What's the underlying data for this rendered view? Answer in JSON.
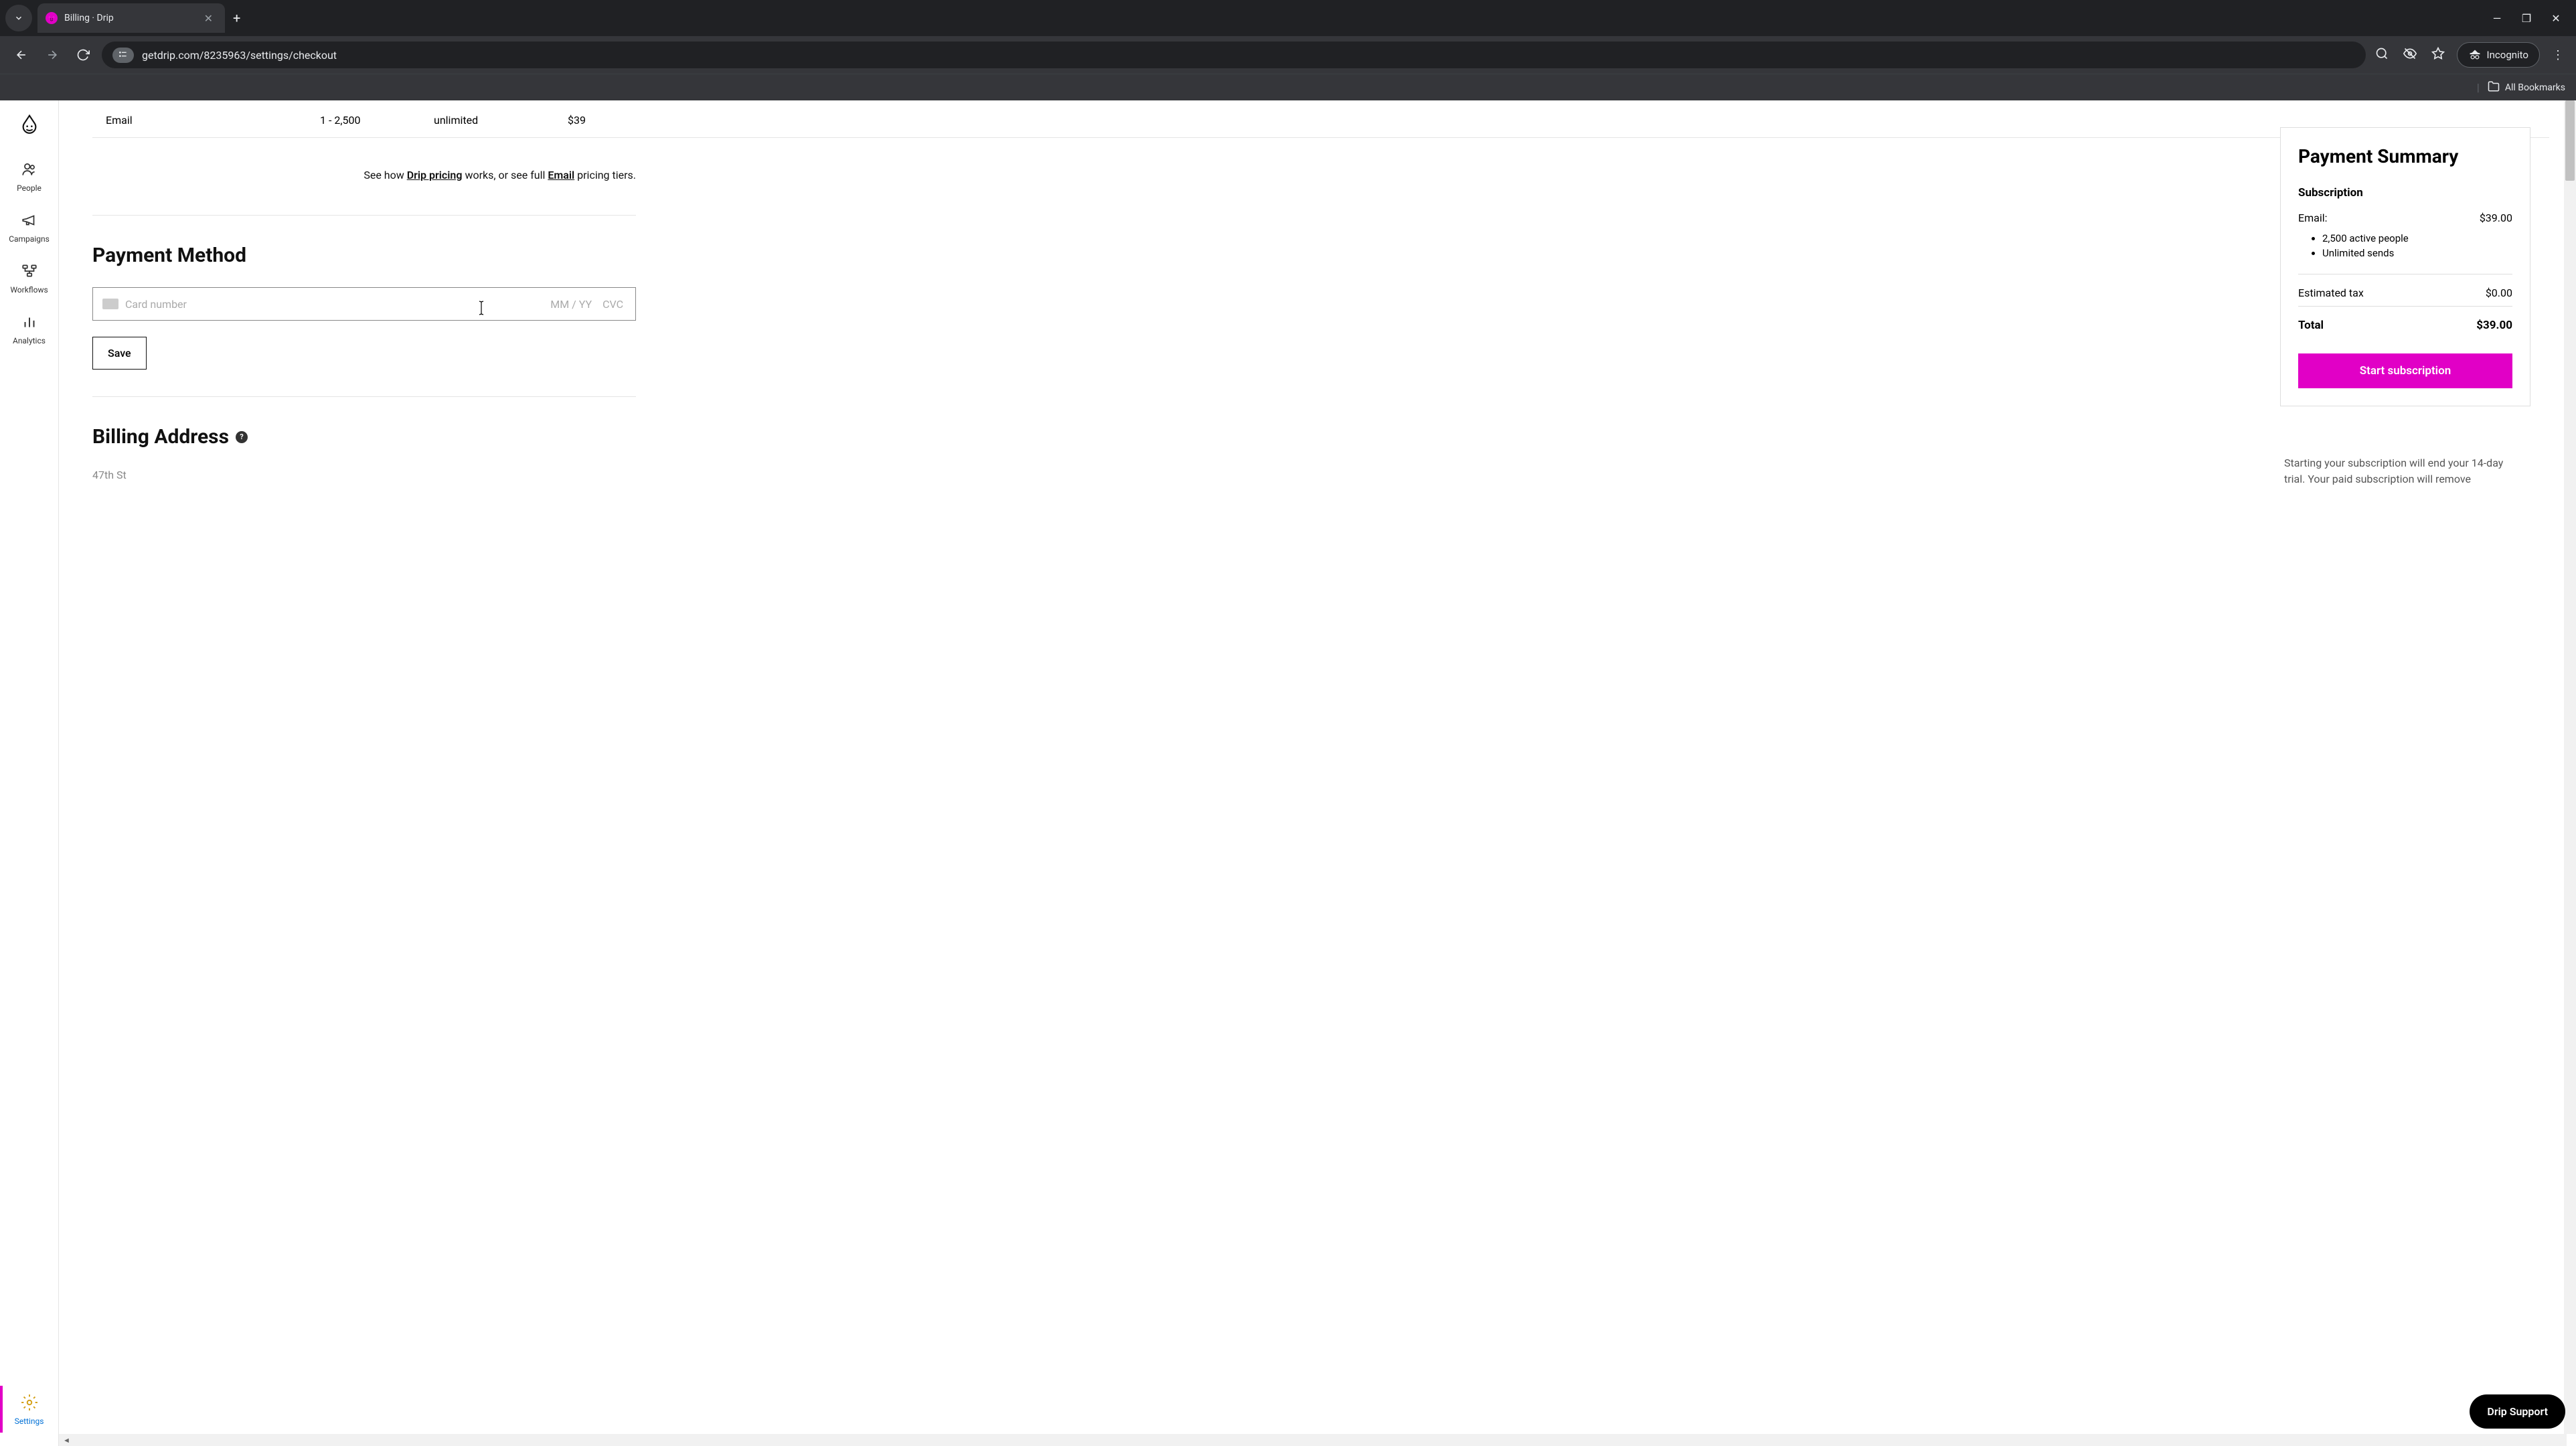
{
  "browser": {
    "tab_title": "Billing · Drip",
    "url": "getdrip.com/8235963/settings/checkout",
    "incognito_label": "Incognito",
    "bookmarks_label": "All Bookmarks"
  },
  "sidebar": {
    "items": [
      {
        "label": "People"
      },
      {
        "label": "Campaigns"
      },
      {
        "label": "Workflows"
      },
      {
        "label": "Analytics"
      },
      {
        "label": "Settings"
      }
    ]
  },
  "plan_row": {
    "name": "Email",
    "range": "1 - 2,500",
    "sends": "unlimited",
    "price": "$39"
  },
  "pricing_note": {
    "prefix": "See how ",
    "link1": "Drip pricing",
    "mid": " works, or see full ",
    "link2": "Email",
    "suffix": " pricing tiers."
  },
  "payment_method": {
    "title": "Payment Method",
    "card_placeholder": "Card number",
    "expiry_placeholder": "MM / YY",
    "cvc_placeholder": "CVC",
    "save_label": "Save"
  },
  "billing_address": {
    "title": "Billing Address",
    "line1": "47th St"
  },
  "summary": {
    "title": "Payment Summary",
    "subscription_label": "Subscription",
    "email_label": "Email:",
    "email_price": "$39.00",
    "features": [
      "2,500 active people",
      "Unlimited sends"
    ],
    "tax_label": "Estimated tax",
    "tax_amount": "$0.00",
    "total_label": "Total",
    "total_amount": "$39.00",
    "start_label": "Start subscription"
  },
  "trial_note": "Starting your subscription will end your 14-day trial. Your paid subscription will remove",
  "support_label": "Drip Support"
}
